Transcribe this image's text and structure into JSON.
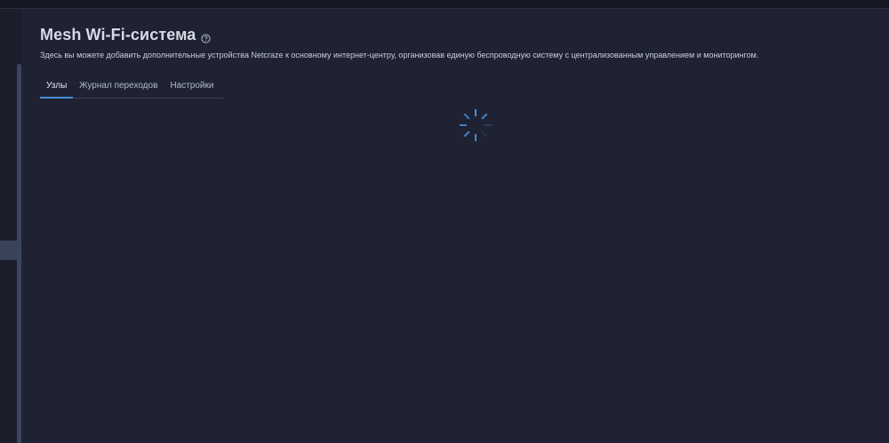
{
  "page": {
    "title": "Mesh Wi-Fi-система",
    "description": "Здесь вы можете добавить дополнительные устройства Netcraze к основному интернет-центру, организовав единую беспроводную систему с централизованным управлением и мониторингом."
  },
  "tabs": [
    {
      "label": "Узлы",
      "active": true
    },
    {
      "label": "Журнал переходов",
      "active": false
    },
    {
      "label": "Настройки",
      "active": false
    }
  ],
  "icons": {
    "help": "help-circle-icon",
    "loading": "loading-spinner-icon"
  },
  "colors": {
    "background": "#1e2232",
    "accent": "#4a90d9",
    "spinner": "#4a90d9"
  }
}
